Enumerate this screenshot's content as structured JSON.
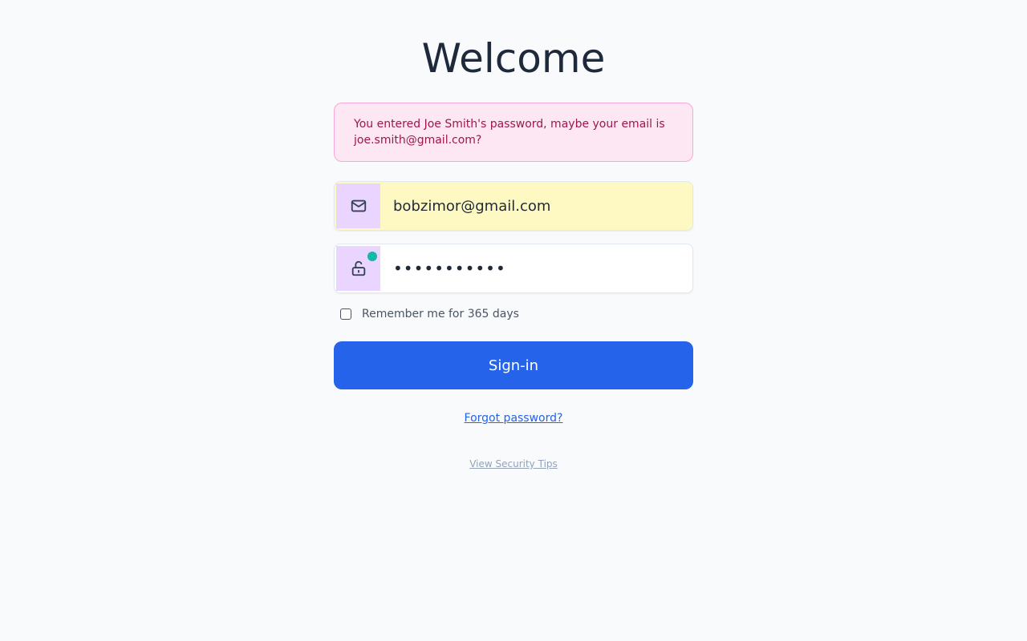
{
  "page": {
    "title": "Welcome"
  },
  "alert": {
    "message": "You entered Joe Smith's password, maybe your email is joe.smith@gmail.com?"
  },
  "email_field": {
    "value": "bobzimor@gmail.com",
    "icon": "mail-icon"
  },
  "password_field": {
    "value": "•••••••••••",
    "icon": "unlock-icon",
    "status_dot_color": "#14b8a6"
  },
  "remember": {
    "label": "Remember me for 365 days",
    "checked": false
  },
  "signin_button": {
    "label": "Sign-in"
  },
  "links": {
    "forgot_password": "Forgot password?",
    "security_tips": "View Security Tips"
  },
  "colors": {
    "primary": "#2563eb",
    "alert_bg": "#fce7f3",
    "alert_text": "#9d174d",
    "icon_bg": "#e9d5ff",
    "email_highlight": "#fef9c3"
  }
}
